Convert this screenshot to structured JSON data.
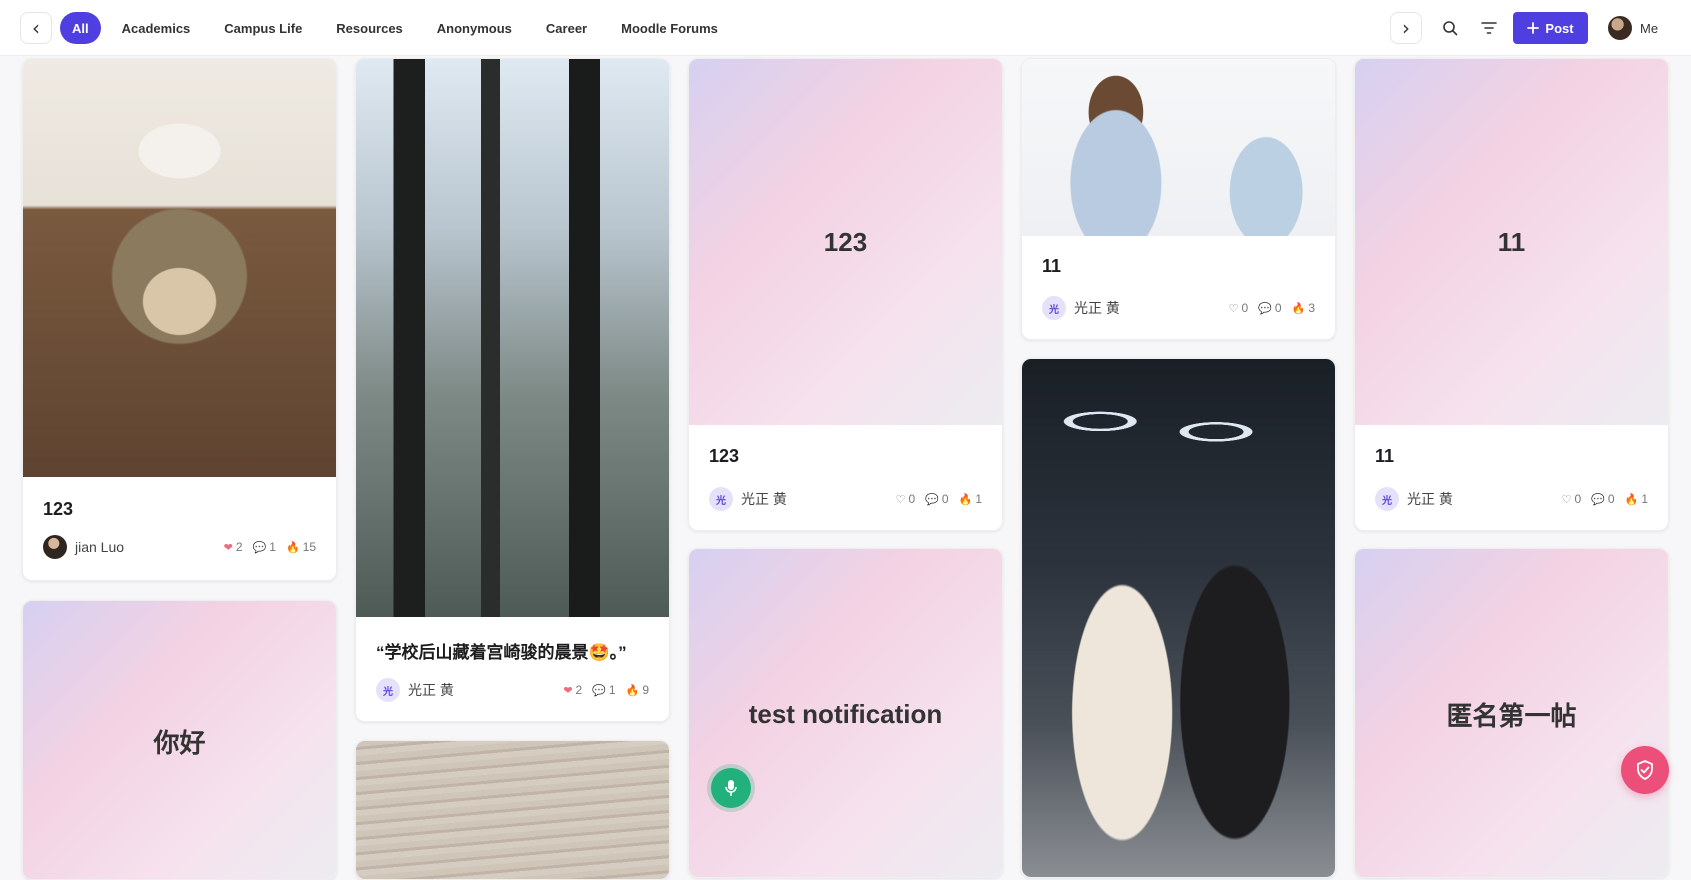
{
  "nav": {
    "prev_glyph": "‹",
    "next_glyph": "›",
    "tabs": [
      {
        "label": "All",
        "active": true
      },
      {
        "label": "Academics"
      },
      {
        "label": "Campus Life"
      },
      {
        "label": "Resources"
      },
      {
        "label": "Anonymous"
      },
      {
        "label": "Career"
      },
      {
        "label": "Moodle Forums"
      }
    ]
  },
  "toolbar": {
    "search_icon": "search-icon",
    "filter_icon": "filter-icon",
    "post_label": "Post",
    "me_label": "Me"
  },
  "accent": "#4f3fe0",
  "posts": [
    {
      "title": "123",
      "author": "jian Luo",
      "likes": "2",
      "comments": "1",
      "views": "15",
      "media": "photo-cat"
    },
    {
      "title": "你好",
      "media": "gradient-text"
    },
    {
      "title": "“学校后山藏着宫崎骏的晨景🤩。”",
      "author": "光正 黄",
      "avatar": "光",
      "likes": "2",
      "comments": "1",
      "views": "9",
      "media": "photo-forest"
    },
    {
      "media": "photo-wood"
    },
    {
      "title": "123",
      "cover_text": "123",
      "author": "光正 黄",
      "avatar": "光",
      "likes": "0",
      "comments": "0",
      "views": "1",
      "media": "gradient-text"
    },
    {
      "title": "test notification",
      "media": "gradient-text"
    },
    {
      "title": "11",
      "author": "光正 黄",
      "avatar": "光",
      "likes": "0",
      "comments": "0",
      "views": "3",
      "media": "photo-jackets"
    },
    {
      "media": "photo-gym"
    },
    {
      "title": "11",
      "cover_text": "11",
      "author": "光正 黄",
      "avatar": "光",
      "likes": "0",
      "comments": "0",
      "views": "1",
      "media": "gradient-text"
    },
    {
      "title": "匿名第一帖",
      "media": "gradient-text"
    }
  ],
  "floating": {
    "mic_icon": "microphone-icon",
    "shield_icon": "shield-check-icon"
  }
}
